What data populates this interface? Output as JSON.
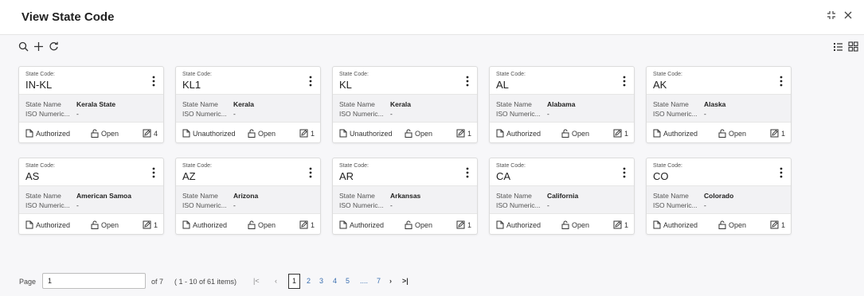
{
  "header": {
    "title": "View State Code"
  },
  "cards": [
    {
      "code_label": "State Code:",
      "code": "IN-KL",
      "name_label": "State Name",
      "name": "Kerala State",
      "iso_label": "ISO Numeric...",
      "iso": "-",
      "auth": "Authorized",
      "status": "Open",
      "count": "4"
    },
    {
      "code_label": "State Code:",
      "code": "KL1",
      "name_label": "State Name",
      "name": "Kerala",
      "iso_label": "ISO Numeric...",
      "iso": "-",
      "auth": "Unauthorized",
      "status": "Open",
      "count": "1"
    },
    {
      "code_label": "State Code:",
      "code": "KL",
      "name_label": "State Name",
      "name": "Kerala",
      "iso_label": "ISO Numeric...",
      "iso": "-",
      "auth": "Unauthorized",
      "status": "Open",
      "count": "1"
    },
    {
      "code_label": "State Code:",
      "code": "AL",
      "name_label": "State Name",
      "name": "Alabama",
      "iso_label": "ISO Numeric...",
      "iso": "-",
      "auth": "Authorized",
      "status": "Open",
      "count": "1"
    },
    {
      "code_label": "State Code:",
      "code": "AK",
      "name_label": "State Name",
      "name": "Alaska",
      "iso_label": "ISO Numeric...",
      "iso": "-",
      "auth": "Authorized",
      "status": "Open",
      "count": "1"
    },
    {
      "code_label": "State Code:",
      "code": "AS",
      "name_label": "State Name",
      "name": "American Samoa",
      "iso_label": "ISO Numeric...",
      "iso": "-",
      "auth": "Authorized",
      "status": "Open",
      "count": "1"
    },
    {
      "code_label": "State Code:",
      "code": "AZ",
      "name_label": "State Name",
      "name": "Arizona",
      "iso_label": "ISO Numeric...",
      "iso": "-",
      "auth": "Authorized",
      "status": "Open",
      "count": "1"
    },
    {
      "code_label": "State Code:",
      "code": "AR",
      "name_label": "State Name",
      "name": "Arkansas",
      "iso_label": "ISO Numeric...",
      "iso": "-",
      "auth": "Authorized",
      "status": "Open",
      "count": "1"
    },
    {
      "code_label": "State Code:",
      "code": "CA",
      "name_label": "State Name",
      "name": "California",
      "iso_label": "ISO Numeric...",
      "iso": "-",
      "auth": "Authorized",
      "status": "Open",
      "count": "1"
    },
    {
      "code_label": "State Code:",
      "code": "CO",
      "name_label": "State Name",
      "name": "Colorado",
      "iso_label": "ISO Numeric...",
      "iso": "-",
      "auth": "Authorized",
      "status": "Open",
      "count": "1"
    }
  ],
  "pagination": {
    "page_label": "Page",
    "page_value": "1",
    "of_label": "of 7",
    "items_label": "( 1 - 10 of 61 items)",
    "first": "|<",
    "prev": "‹",
    "current": "1",
    "pages": [
      "2",
      "3",
      "4",
      "5",
      "....",
      "7"
    ],
    "next": "›",
    "last": ">|"
  }
}
